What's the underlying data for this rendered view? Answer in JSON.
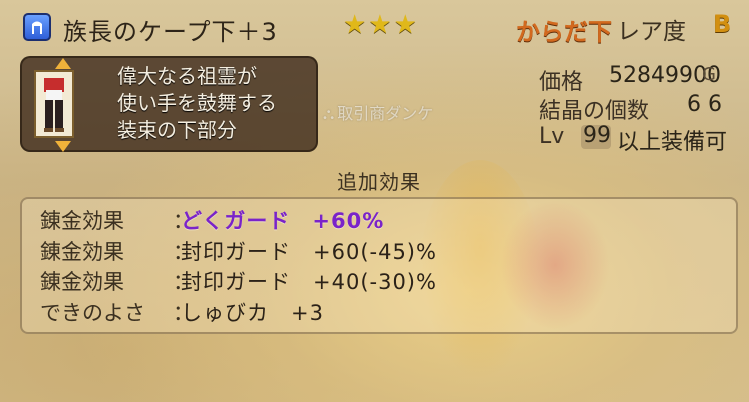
{
  "item": {
    "name": "族長のケープ下＋3",
    "stars": "★★★",
    "slot": "からだ下",
    "rarity_label": "レア度",
    "rarity_value": "B",
    "description": "偉大なる祖霊が\n使い手を鼓舞する\n装束の下部分"
  },
  "trader": {
    "label": "取引商ダンケ",
    "icon": "trader-icon"
  },
  "stats": {
    "price_label": "価格",
    "price_value": "52849900",
    "price_unit": "G",
    "crystal_label": "結晶の個数",
    "crystal_value": "6 6",
    "lv_label": "Lv",
    "lv_value": "99",
    "lv_suffix": "以上装備可"
  },
  "effects": {
    "heading": "追加効果",
    "rows": [
      {
        "label": "錬金効果",
        "colon": "：",
        "value": "どくガード　+60%"
      },
      {
        "label": "錬金効果",
        "colon": "：",
        "value": "封印ガード　+60(-45)%"
      },
      {
        "label": "錬金効果",
        "colon": "：",
        "value": "封印ガード　+40(-30)%"
      },
      {
        "label": "できのよさ",
        "colon": "：",
        "value": "しゅびカ　+3"
      }
    ]
  },
  "colors": {
    "highlight_effect": "#7a23c9",
    "slot": "#d2691e",
    "stars": "#e0b81a"
  }
}
